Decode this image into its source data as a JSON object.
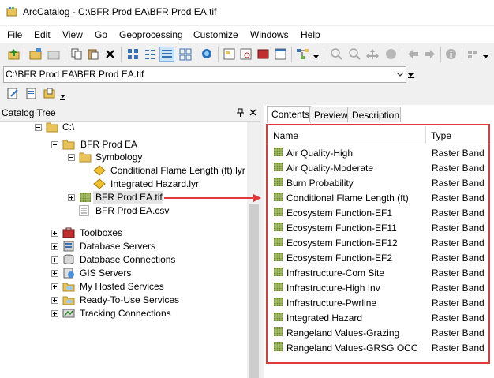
{
  "window": {
    "title": "ArcCatalog - C:\\BFR Prod EA\\BFR Prod EA.tif"
  },
  "menu": [
    "File",
    "Edit",
    "View",
    "Go",
    "Geoprocessing",
    "Customize",
    "Windows",
    "Help"
  ],
  "location": {
    "value": "C:\\BFR Prod EA\\BFR Prod EA.tif"
  },
  "catalog_tree": {
    "title": "Catalog Tree",
    "pin": "ᵖ",
    "close": "✕",
    "nodes": [
      {
        "label": "C:\\"
      },
      {
        "label": "BFR Prod EA"
      },
      {
        "label": "Symbology"
      },
      {
        "label": "Conditional Flame Length (ft).lyr"
      },
      {
        "label": "Integrated Hazard.lyr"
      },
      {
        "label": "BFR Prod EA.tif"
      },
      {
        "label": "BFR Prod EA.csv"
      },
      {
        "label": "Toolboxes"
      },
      {
        "label": "Database Servers"
      },
      {
        "label": "Database Connections"
      },
      {
        "label": "GIS Servers"
      },
      {
        "label": "My Hosted Services"
      },
      {
        "label": "Ready-To-Use Services"
      },
      {
        "label": "Tracking Connections"
      }
    ]
  },
  "tabs": [
    "Contents",
    "Preview",
    "Description"
  ],
  "contents": {
    "columns": {
      "name": "Name",
      "type": "Type"
    },
    "rows": [
      {
        "name": "Air Quality-High",
        "type": "Raster Band"
      },
      {
        "name": "Air Quality-Moderate",
        "type": "Raster Band"
      },
      {
        "name": "Burn Probability",
        "type": "Raster Band"
      },
      {
        "name": "Conditional Flame Length (ft)",
        "type": "Raster Band"
      },
      {
        "name": "Ecosystem Function-EF1",
        "type": "Raster Band"
      },
      {
        "name": "Ecosystem Function-EF11",
        "type": "Raster Band"
      },
      {
        "name": "Ecosystem Function-EF12",
        "type": "Raster Band"
      },
      {
        "name": "Ecosystem Function-EF2",
        "type": "Raster Band"
      },
      {
        "name": "Infrastructure-Com Site",
        "type": "Raster Band"
      },
      {
        "name": "Infrastructure-High Inv",
        "type": "Raster Band"
      },
      {
        "name": "Infrastructure-Pwrline",
        "type": "Raster Band"
      },
      {
        "name": "Integrated Hazard",
        "type": "Raster Band"
      },
      {
        "name": "Rangeland Values-Grazing",
        "type": "Raster Band"
      },
      {
        "name": "Rangeland Values-GRSG OCC",
        "type": "Raster Band"
      }
    ]
  },
  "colors": {
    "annotation_red": "#e03a3a",
    "folder": "#e8c25a",
    "layer": "#f0c030"
  }
}
